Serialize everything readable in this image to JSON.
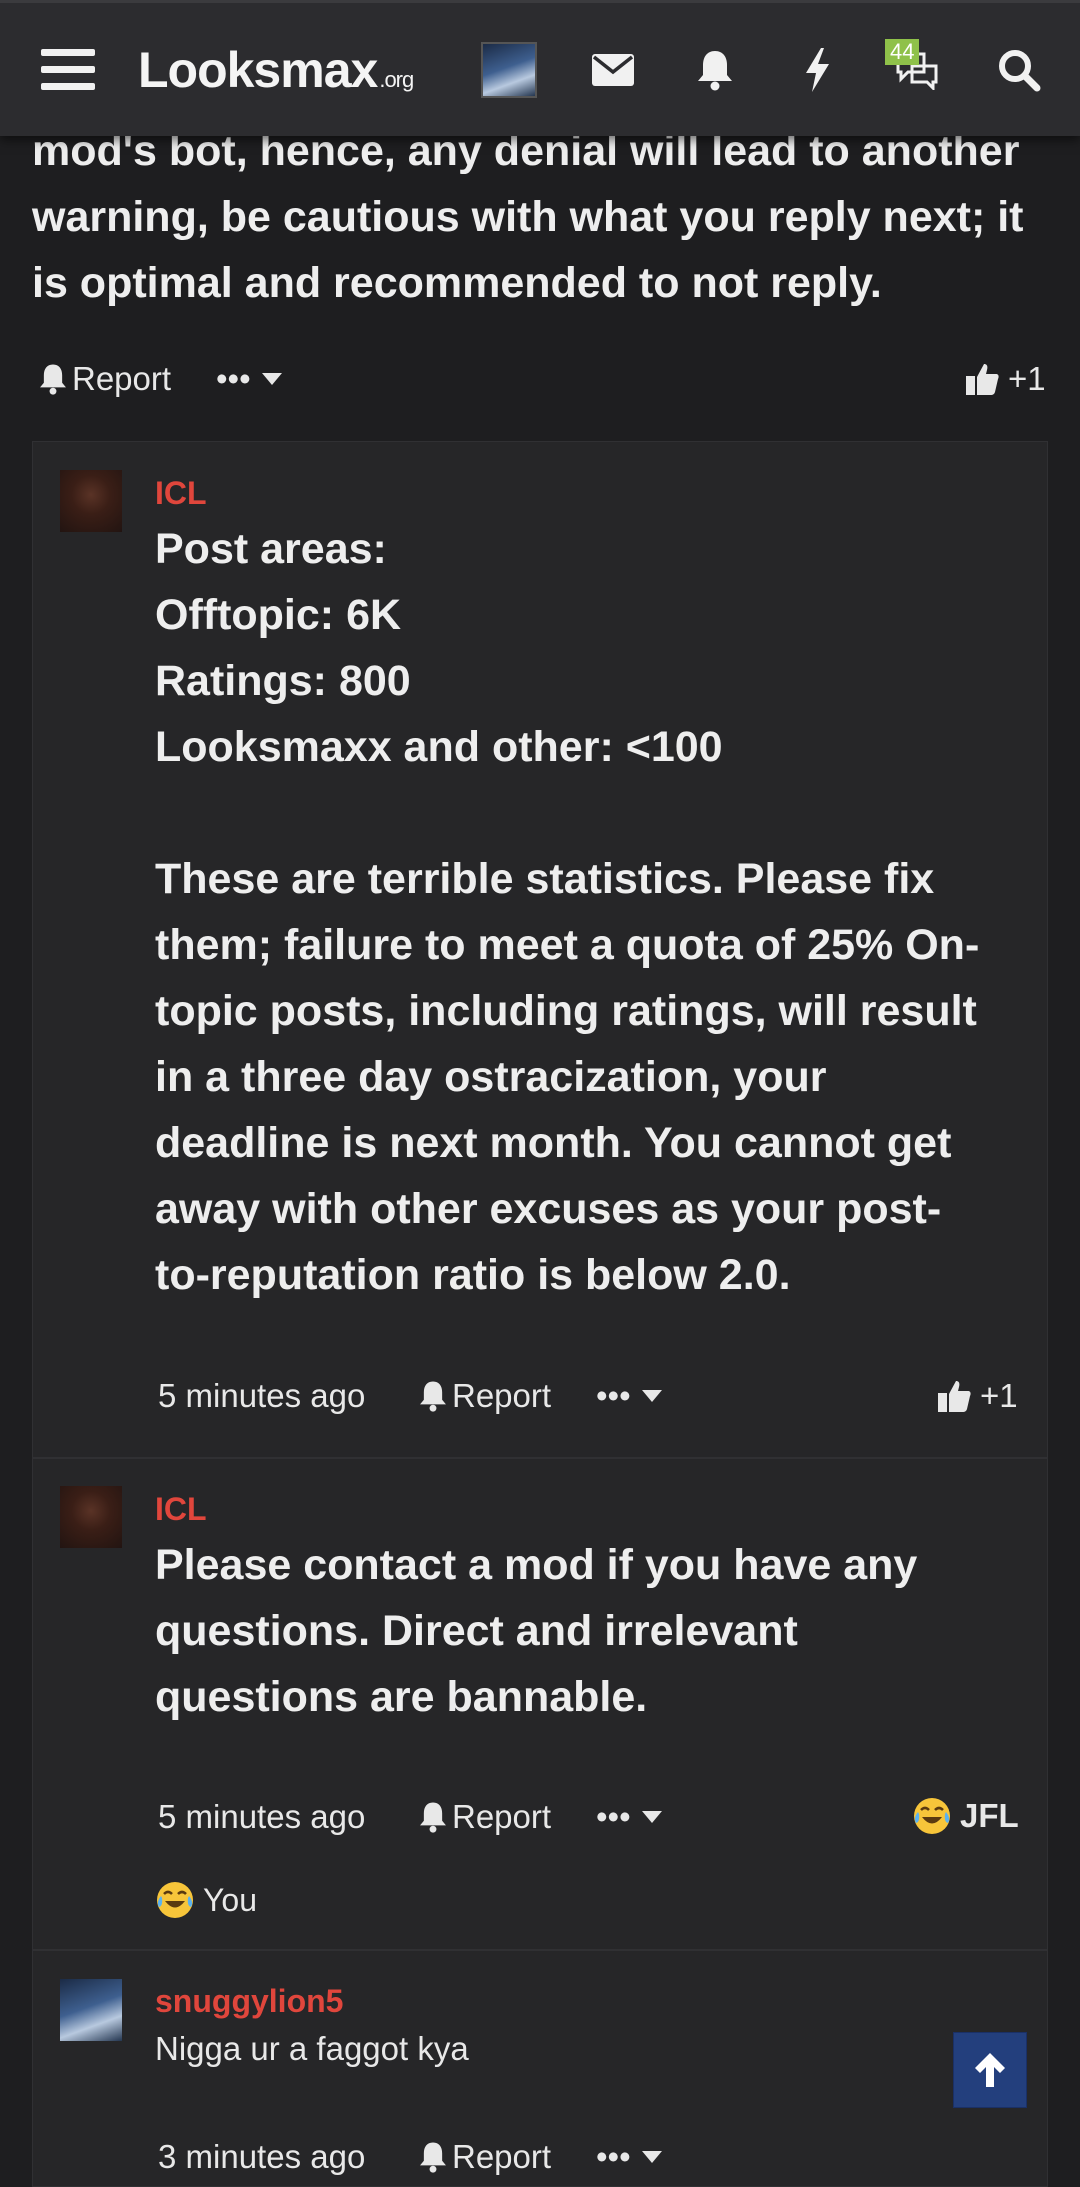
{
  "header": {
    "logo_main": "Looksmax",
    "logo_tld": ".org",
    "badge_count": "44"
  },
  "top_post": {
    "lines": [
      "mod's bot, hence, any denial will lead to another",
      "warning, be cautious with what you reply next; it",
      "is optimal and recommended to not reply."
    ],
    "report_label": "Report",
    "more_label": "•••",
    "like_count": "+1"
  },
  "replies": [
    {
      "username": "ICL",
      "lines": [
        "Post areas:",
        "Offtopic: 6K",
        "Ratings: 800",
        "Looksmaxx and other: <100",
        "",
        "These are terrible statistics. Please fix",
        "them; failure to meet a quota of 25% On-",
        "topic posts, including ratings, will result",
        "in a three day ostracization, your",
        "deadline is next month. You cannot get",
        "away with other excuses as your post-",
        "to-reputation ratio is below 2.0."
      ],
      "time": "5 minutes ago",
      "report_label": "Report",
      "more_label": "•••",
      "like_count": "+1"
    },
    {
      "username": "ICL",
      "lines": [
        "Please contact a mod if you have any",
        "questions. Direct and irrelevant",
        "questions are bannable."
      ],
      "time": "5 minutes ago",
      "report_label": "Report",
      "more_label": "•••",
      "reaction_label": "JFL",
      "reacted_by": "You"
    },
    {
      "username": "snuggylion5",
      "lines": [
        "Nigga ur a faggot kya"
      ],
      "time": "3 minutes ago",
      "report_label": "Report",
      "more_label": "•••"
    }
  ],
  "colors": {
    "background": "#1e1e20",
    "card": "#262628",
    "header": "#2c2c2f",
    "username": "#e0463c",
    "badge": "#8fc14a",
    "scroll_button": "#233f7d"
  }
}
